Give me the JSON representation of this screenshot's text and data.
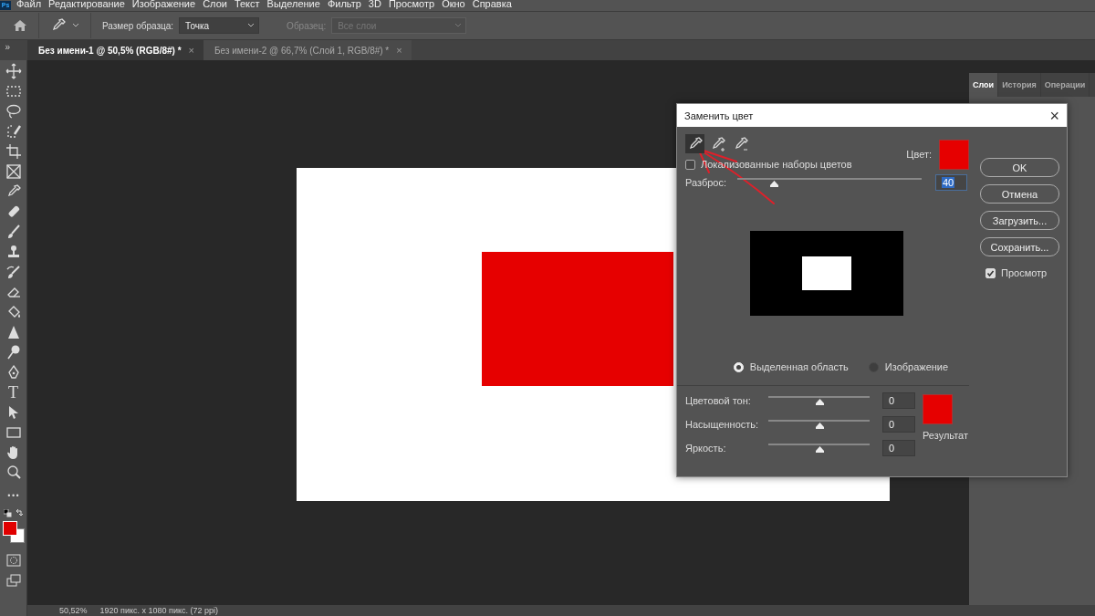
{
  "app_logo": "Ps",
  "menu": [
    "Файл",
    "Редактирование",
    "Изображение",
    "Слои",
    "Текст",
    "Выделение",
    "Фильтр",
    "3D",
    "Просмотр",
    "Окно",
    "Справка"
  ],
  "options_bar": {
    "sample_size_label": "Размер образца:",
    "sample_size_value": "Точка",
    "sample_label": "Образец:",
    "sample_value": "Все слои",
    "sample_disabled": true
  },
  "panel_toggle": "»",
  "tabs": [
    {
      "label": "Без имени-1 @ 50,5% (RGB/8#) *",
      "selected": true,
      "close": "×"
    },
    {
      "label": "Без имени-2 @ 66,7% (Слой 1, RGB/8#) *",
      "selected": false,
      "close": "×"
    }
  ],
  "toolbar": {
    "text_tool_glyph": "T",
    "more_glyph": "•••"
  },
  "right_panel": {
    "tabs": [
      {
        "label": "Слои",
        "selected": true
      },
      {
        "label": "История",
        "selected": false
      },
      {
        "label": "Операции",
        "selected": false
      }
    ]
  },
  "dialog": {
    "title": "Заменить цвет",
    "close": "×",
    "eyedroppers": [
      {
        "kind": "plain",
        "selected": true
      },
      {
        "kind": "add",
        "selected": false
      },
      {
        "kind": "subtract",
        "selected": false
      }
    ],
    "localized_label": "Локализованные наборы цветов",
    "localized_checked": false,
    "color_label": "Цвет:",
    "fuzziness": {
      "label": "Разброс:",
      "level": 0.2,
      "value": "40"
    },
    "selection_options": [
      {
        "label": "Выделенная область",
        "selected": true
      },
      {
        "label": "Изображение",
        "selected": false
      }
    ],
    "adjustments": [
      {
        "label": "Цветовой тон:",
        "level": 0.5,
        "value": "0"
      },
      {
        "label": "Насыщенность:",
        "level": 0.5,
        "value": "0"
      },
      {
        "label": "Яркость:",
        "level": 0.5,
        "value": "0"
      }
    ],
    "result_label": "Результат",
    "buttons": [
      "OK",
      "Отмена",
      "Загрузить...",
      "Сохранить..."
    ],
    "preview_label": "Просмотр",
    "preview_checked": true
  },
  "status_bar": {
    "zoom": "50,52%",
    "doc_info": "1920 пикс. x 1080 пикс. (72 ppi)"
  }
}
